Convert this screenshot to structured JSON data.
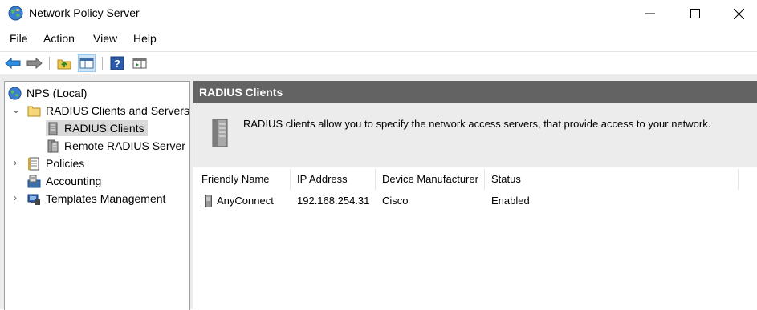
{
  "window": {
    "title": "Network Policy Server",
    "icons": {
      "app": "globe-icon",
      "minimize": "minimize-icon",
      "maximize": "maximize-icon",
      "close": "close-icon"
    }
  },
  "menu": [
    "File",
    "Action",
    "View",
    "Help"
  ],
  "toolbar": {
    "buttons": [
      "back-arrow-icon",
      "forward-arrow-icon",
      "up-folder-icon",
      "show-console-tree-icon",
      "help-icon",
      "show-action-pane-icon"
    ]
  },
  "tree": {
    "root": "NPS (Local)",
    "items": [
      {
        "label": "RADIUS Clients and Servers",
        "expanded": true
      },
      {
        "label": "RADIUS Clients",
        "selected": true
      },
      {
        "label": "Remote RADIUS Server"
      },
      {
        "label": "Policies",
        "expanded": false
      },
      {
        "label": "Accounting"
      },
      {
        "label": "Templates Management",
        "expanded": false
      }
    ]
  },
  "pane": {
    "header": "RADIUS Clients",
    "description": "RADIUS clients allow you to specify the network access servers, that provide access to your network."
  },
  "table": {
    "columns": [
      "Friendly Name",
      "IP Address",
      "Device Manufacturer",
      "Status"
    ],
    "rows": [
      {
        "name": "AnyConnect",
        "ip": "192.168.254.31",
        "manufacturer": "Cisco",
        "status": "Enabled"
      }
    ]
  }
}
